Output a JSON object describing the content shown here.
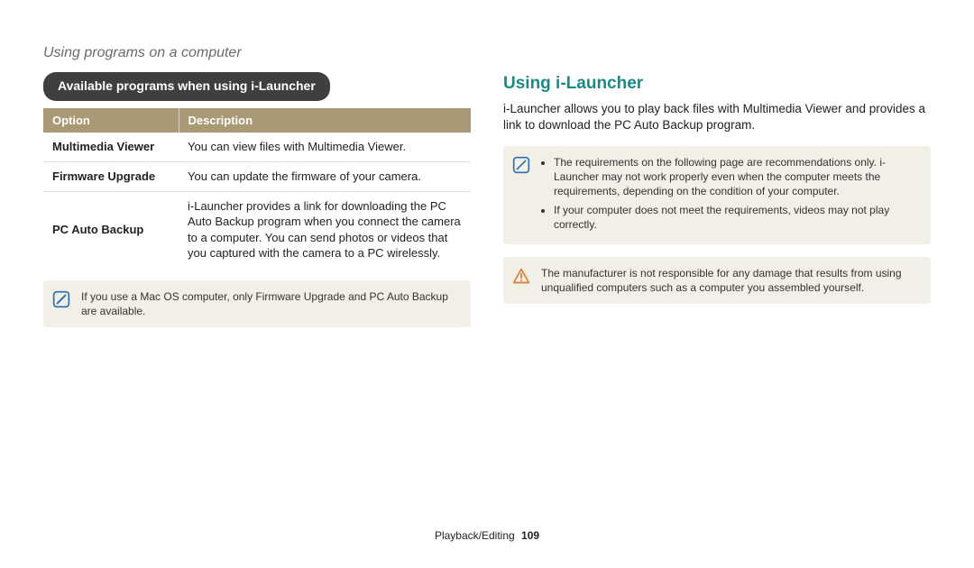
{
  "breadcrumb": "Using programs on a computer",
  "left": {
    "pill": "Available programs when using i-Launcher",
    "table": {
      "head_option": "Option",
      "head_description": "Description",
      "rows": [
        {
          "option": "Multimedia Viewer",
          "desc": "You can view files with Multimedia Viewer."
        },
        {
          "option": "Firmware Upgrade",
          "desc": "You can update the firmware of your camera."
        },
        {
          "option": "PC Auto Backup",
          "desc": "i-Launcher provides a link for downloading the PC Auto Backup program when you connect the camera to a computer. You can send photos or videos that you captured with the camera to a PC wirelessly."
        }
      ]
    },
    "note": "If you use a Mac OS computer, only Firmware Upgrade and PC Auto Backup are available."
  },
  "right": {
    "heading": "Using i-Launcher",
    "para": "i-Launcher allows you to play back files with Multimedia Viewer and provides a link to download the PC Auto Backup program.",
    "note_items": [
      "The requirements on the following page are recommendations only. i-Launcher may not work properly even when the computer meets the requirements, depending on the condition of your computer.",
      "If your computer does not meet the requirements, videos may not play correctly."
    ],
    "warning": "The manufacturer is not responsible for any damage that results from using unqualified computers such as a computer you assembled yourself."
  },
  "footer": {
    "section": "Playback/Editing",
    "page": "109"
  }
}
